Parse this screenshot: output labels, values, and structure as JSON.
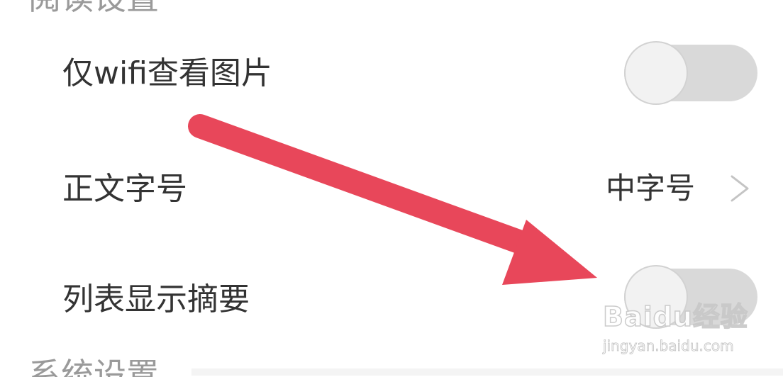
{
  "sections": {
    "reading_settings_title": "阅读设置",
    "system_settings_title": "系统设置"
  },
  "rows": {
    "wifi_images": {
      "label": "仅wifi查看图片",
      "toggle_on": false
    },
    "font_size": {
      "label": "正文字号",
      "value": "中字号",
      "chevron_icon": "chevron-right-icon"
    },
    "list_summary": {
      "label": "列表显示摘要",
      "toggle_on": false
    }
  },
  "annotation": {
    "arrow_color": "#e8475a"
  },
  "watermark": {
    "brand_text": "Baidu经验",
    "url_text": "jingyan.baidu.com"
  },
  "colors": {
    "toggle_track_off": "#d9d9d9",
    "toggle_knob": "#f2f2f2",
    "text_primary": "#333333",
    "text_header": "#9a9a9a"
  }
}
